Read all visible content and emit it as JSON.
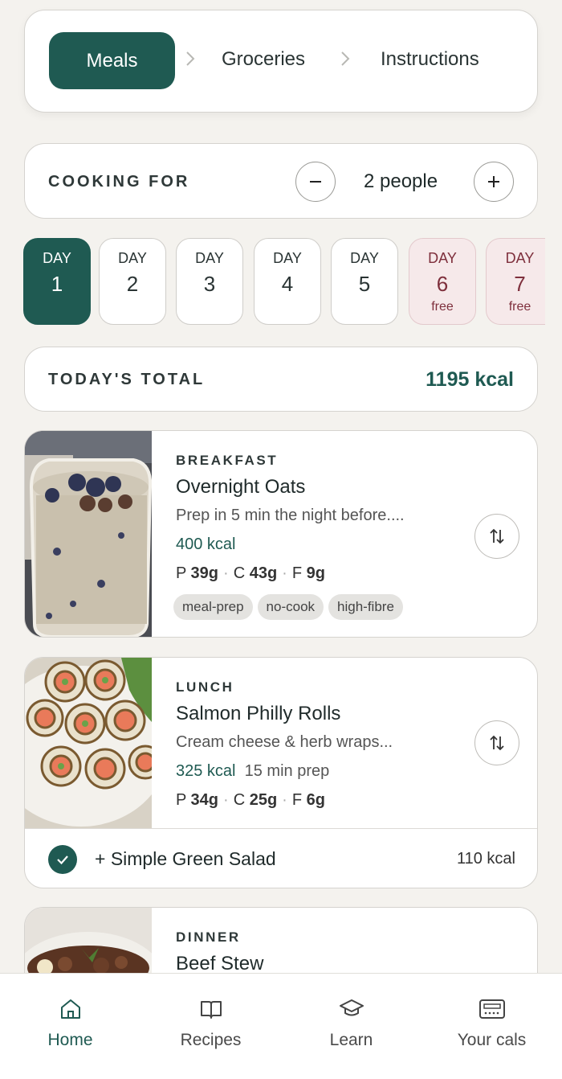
{
  "steps": [
    {
      "label": "Meals",
      "active": true
    },
    {
      "label": "Groceries",
      "active": false
    },
    {
      "label": "Instructions",
      "active": false
    }
  ],
  "cooking_for": {
    "label": "COOKING FOR",
    "value": "2 people",
    "minus_icon": "minus-icon",
    "plus_icon": "plus-icon"
  },
  "days": [
    {
      "label": "DAY",
      "num": "1",
      "sub": "",
      "state": "active"
    },
    {
      "label": "DAY",
      "num": "2",
      "sub": "",
      "state": "normal"
    },
    {
      "label": "DAY",
      "num": "3",
      "sub": "",
      "state": "normal"
    },
    {
      "label": "DAY",
      "num": "4",
      "sub": "",
      "state": "normal"
    },
    {
      "label": "DAY",
      "num": "5",
      "sub": "",
      "state": "normal"
    },
    {
      "label": "DAY",
      "num": "6",
      "sub": "free",
      "state": "free"
    },
    {
      "label": "DAY",
      "num": "7",
      "sub": "free",
      "state": "free"
    }
  ],
  "total": {
    "label": "TODAY'S TOTAL",
    "value": "1195 kcal"
  },
  "meals": [
    {
      "type": "BREAKFAST",
      "name": "Overnight Oats",
      "desc": "Prep in 5 min the night before....",
      "kcal": "400 kcal",
      "prep": "",
      "p": "39g",
      "c": "43g",
      "f": "9g",
      "tags": [
        "meal-prep",
        "no-cook",
        "high-fibre"
      ]
    },
    {
      "type": "LUNCH",
      "name": "Salmon Philly Rolls",
      "desc": "Cream cheese & herb wraps...",
      "kcal": "325 kcal",
      "prep": "15 min prep",
      "p": "34g",
      "c": "25g",
      "f": "6g",
      "side": {
        "label": "+ Simple Green Salad",
        "kcal": "110 kcal"
      }
    },
    {
      "type": "DINNER",
      "name": "Beef Stew"
    }
  ],
  "macro_labels": {
    "p": "P",
    "c": "C",
    "f": "F"
  },
  "nav": [
    {
      "label": "Home",
      "icon": "home-icon",
      "active": true
    },
    {
      "label": "Recipes",
      "icon": "book-icon",
      "active": false
    },
    {
      "label": "Learn",
      "icon": "graduation-cap-icon",
      "active": false
    },
    {
      "label": "Your cals",
      "icon": "calculator-icon",
      "active": false
    }
  ],
  "colors": {
    "accent": "#1f5a52",
    "free_bg": "#f6e9ea",
    "free_text": "#7e2f3c",
    "background": "#f4f2ee"
  }
}
